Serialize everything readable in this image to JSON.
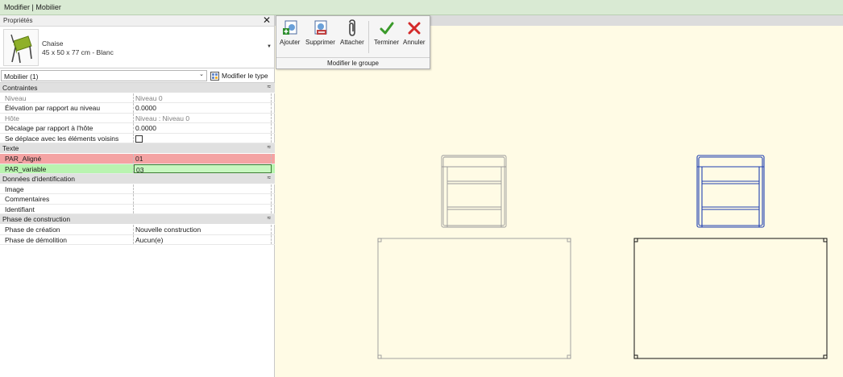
{
  "window": {
    "title": "Modifier | Mobilier"
  },
  "properties": {
    "header": "Propriétés",
    "close_glyph": "✕",
    "type": {
      "name": "Chaise",
      "dimensions": "45 x 50 x 77 cm - Blanc"
    },
    "selector": {
      "value": "Mobilier (1)"
    },
    "edit_type_label": "Modifier le type",
    "categories": {
      "contraintes": "Contraintes",
      "texte": "Texte",
      "donnees": "Données d'identification",
      "phase": "Phase de construction"
    },
    "rows": {
      "niveau": {
        "key": "Niveau",
        "value": "Niveau 0"
      },
      "elevation": {
        "key": "Élévation par rapport au niveau",
        "value": "0.0000"
      },
      "hote": {
        "key": "Hôte",
        "value": "Niveau : Niveau 0"
      },
      "decalage": {
        "key": "Décalage par rapport à l'hôte",
        "value": "0.0000"
      },
      "deplace": {
        "key": "Se déplace avec les éléments voisins",
        "value": ""
      },
      "par_aligne": {
        "key": "PAR_Aligné",
        "value": "01"
      },
      "par_variable": {
        "key": "PAR_variable",
        "value": "03"
      },
      "image": {
        "key": "Image",
        "value": ""
      },
      "commentaires": {
        "key": "Commentaires",
        "value": ""
      },
      "identifiant": {
        "key": "Identifiant",
        "value": ""
      },
      "creation": {
        "key": "Phase de création",
        "value": "Nouvelle construction"
      },
      "demolition": {
        "key": "Phase de démolition",
        "value": "Aucun(e)"
      }
    }
  },
  "ribbon": {
    "buttons": [
      {
        "label": "Ajouter",
        "icon": "add-member-icon"
      },
      {
        "label": "Supprimer",
        "icon": "remove-member-icon"
      },
      {
        "label": "Attacher",
        "icon": "attach-clip-icon"
      },
      {
        "label": "Terminer",
        "icon": "checkmark-icon"
      },
      {
        "label": "Annuler",
        "icon": "cancel-x-icon"
      }
    ],
    "group_label": "Modifier le groupe"
  },
  "colors": {
    "title_bg": "#d9ead3",
    "canvas_bg": "#fffbe5",
    "highlight_red": "#f4a3a3",
    "highlight_green": "#b9f4b0",
    "selected_blue": "#1f3fb0",
    "check_green": "#3a9a2a",
    "cancel_red": "#d42a2a"
  }
}
